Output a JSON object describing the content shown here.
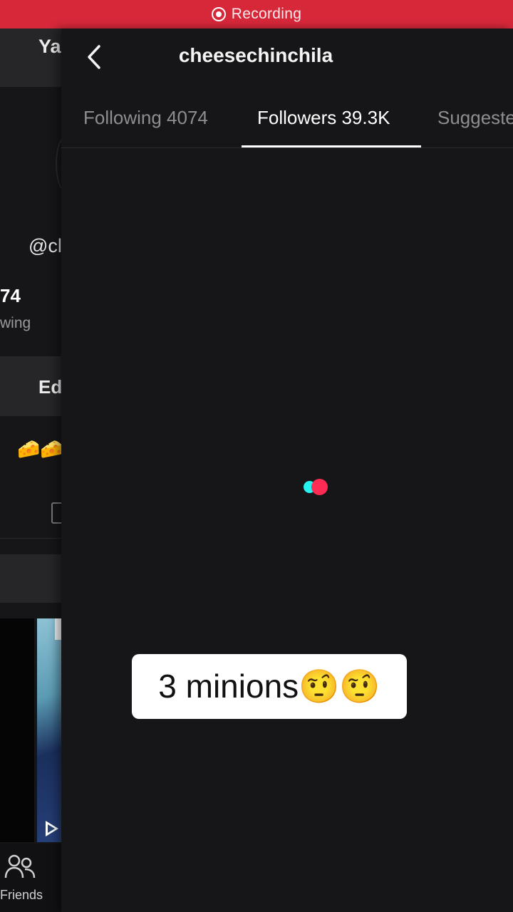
{
  "recording": {
    "label": "Recording"
  },
  "background_profile": {
    "header_text": "Ya",
    "handle": "@cl",
    "count": "74",
    "count_label": "wing",
    "edit_button": "Ed",
    "bio_emojis": "🧀🧀",
    "bottom_nav": {
      "friends_label": "Friends"
    }
  },
  "followers_panel": {
    "title": "cheesechinchila",
    "tabs": [
      {
        "label": "Following 4074",
        "active": false
      },
      {
        "label": "Followers 39.3K",
        "active": true
      },
      {
        "label": "Suggested",
        "active": false
      }
    ],
    "loading": true
  },
  "caption": {
    "text": "3 minions🤨🤨"
  },
  "colors": {
    "recording_bar": "#d7283a",
    "background": "#161618",
    "loader_cyan": "#25f4ee",
    "loader_red": "#fe2c55"
  }
}
